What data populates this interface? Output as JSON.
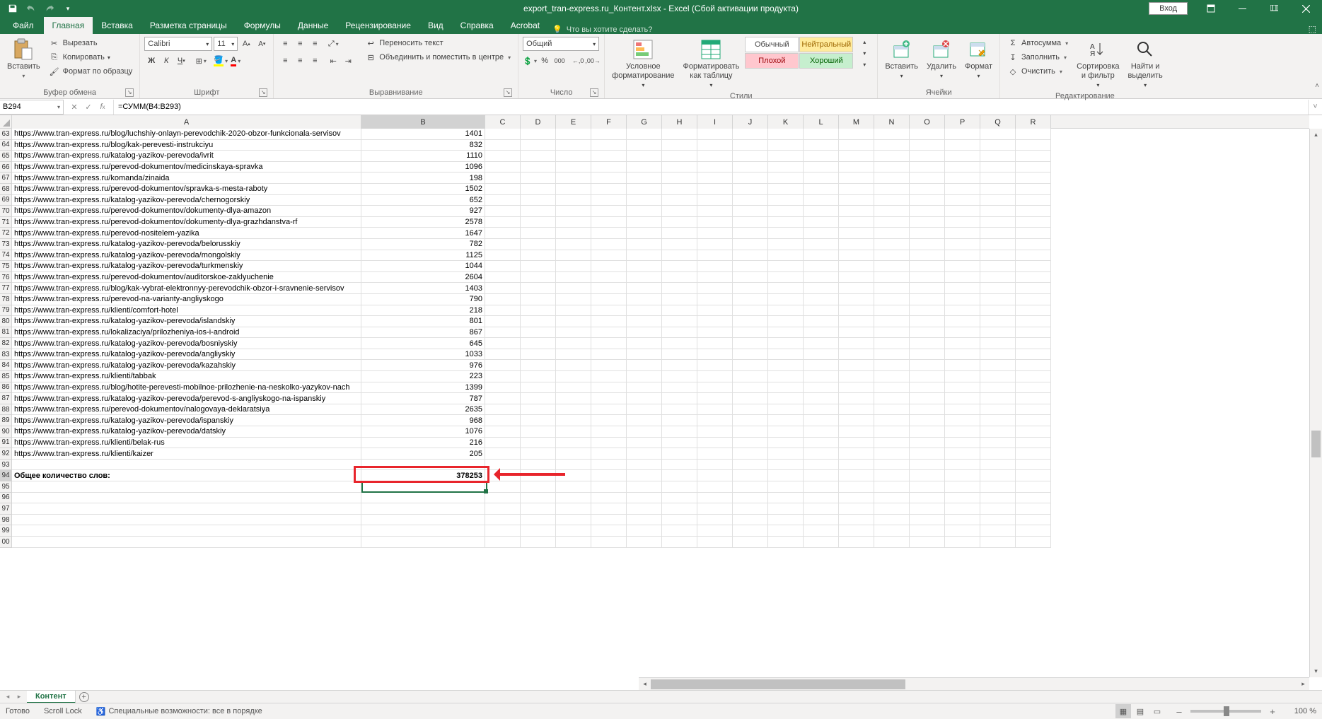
{
  "titlebar": {
    "filename": "export_tran-express.ru_Контент.xlsx - Excel (Сбой активации продукта)",
    "login": "Вход"
  },
  "tabs": {
    "file": "Файл",
    "home": "Главная",
    "insert": "Вставка",
    "layout": "Разметка страницы",
    "formulas": "Формулы",
    "data": "Данные",
    "review": "Рецензирование",
    "view": "Вид",
    "help": "Справка",
    "acrobat": "Acrobat",
    "tellme": "Что вы хотите сделать?"
  },
  "ribbon": {
    "clipboard": {
      "label": "Буфер обмена",
      "paste": "Вставить",
      "cut": "Вырезать",
      "copy": "Копировать",
      "format_painter": "Формат по образцу"
    },
    "font": {
      "label": "Шрифт",
      "family": "Calibri",
      "size": "11"
    },
    "align": {
      "label": "Выравнивание",
      "wrap": "Переносить текст",
      "merge": "Объединить и поместить в центре"
    },
    "number": {
      "label": "Число",
      "format": "Общий"
    },
    "styles": {
      "label": "Стили",
      "conditional": "Условное\nформатирование",
      "as_table": "Форматировать\nкак таблицу",
      "normal": "Обычный",
      "neutral": "Нейтральный",
      "bad": "Плохой",
      "good": "Хороший"
    },
    "cells": {
      "label": "Ячейки",
      "insert": "Вставить",
      "delete": "Удалить",
      "format": "Формат"
    },
    "editing": {
      "label": "Редактирование",
      "autosum": "Автосумма",
      "fill": "Заполнить",
      "clear": "Очистить",
      "sort": "Сортировка\nи фильтр",
      "find": "Найти и\nвыделить"
    }
  },
  "namebox": "B294",
  "formula": "=СУММ(B4:B293)",
  "columns": [
    "A",
    "B",
    "C",
    "D",
    "E",
    "F",
    "G",
    "H",
    "I",
    "J",
    "K",
    "L",
    "M",
    "N",
    "O",
    "P",
    "Q",
    "R"
  ],
  "col_widths": {
    "A": 494,
    "B": 175,
    "rest": 50
  },
  "rows": [
    {
      "n": 63,
      "a": "https://www.tran-express.ru/blog/luchshiy-onlayn-perevodchik-2020-obzor-funkcionala-servisov",
      "b": "1401"
    },
    {
      "n": 64,
      "a": "https://www.tran-express.ru/blog/kak-perevesti-instrukciyu",
      "b": "832"
    },
    {
      "n": 65,
      "a": "https://www.tran-express.ru/katalog-yazikov-perevoda/ivrit",
      "b": "1110"
    },
    {
      "n": 66,
      "a": "https://www.tran-express.ru/perevod-dokumentov/medicinskaya-spravka",
      "b": "1096"
    },
    {
      "n": 67,
      "a": "https://www.tran-express.ru/komanda/zinaida",
      "b": "198"
    },
    {
      "n": 68,
      "a": "https://www.tran-express.ru/perevod-dokumentov/spravka-s-mesta-raboty",
      "b": "1502"
    },
    {
      "n": 69,
      "a": "https://www.tran-express.ru/katalog-yazikov-perevoda/chernogorskiy",
      "b": "652"
    },
    {
      "n": 70,
      "a": "https://www.tran-express.ru/perevod-dokumentov/dokumenty-dlya-amazon",
      "b": "927"
    },
    {
      "n": 71,
      "a": "https://www.tran-express.ru/perevod-dokumentov/dokumenty-dlya-grazhdanstva-rf",
      "b": "2578"
    },
    {
      "n": 72,
      "a": "https://www.tran-express.ru/perevod-nositelem-yazika",
      "b": "1647"
    },
    {
      "n": 73,
      "a": "https://www.tran-express.ru/katalog-yazikov-perevoda/belorusskiy",
      "b": "782"
    },
    {
      "n": 74,
      "a": "https://www.tran-express.ru/katalog-yazikov-perevoda/mongolskiy",
      "b": "1125"
    },
    {
      "n": 75,
      "a": "https://www.tran-express.ru/katalog-yazikov-perevoda/turkmenskiy",
      "b": "1044"
    },
    {
      "n": 76,
      "a": "https://www.tran-express.ru/perevod-dokumentov/auditorskoe-zaklyuchenie",
      "b": "2604"
    },
    {
      "n": 77,
      "a": "https://www.tran-express.ru/blog/kak-vybrat-elektronnyy-perevodchik-obzor-i-sravnenie-servisov",
      "b": "1403"
    },
    {
      "n": 78,
      "a": "https://www.tran-express.ru/perevod-na-varianty-angliyskogo",
      "b": "790"
    },
    {
      "n": 79,
      "a": "https://www.tran-express.ru/klienti/comfort-hotel",
      "b": "218"
    },
    {
      "n": 80,
      "a": "https://www.tran-express.ru/katalog-yazikov-perevoda/islandskiy",
      "b": "801"
    },
    {
      "n": 81,
      "a": "https://www.tran-express.ru/lokalizaciya/prilozheniya-ios-i-android",
      "b": "867"
    },
    {
      "n": 82,
      "a": "https://www.tran-express.ru/katalog-yazikov-perevoda/bosniyskiy",
      "b": "645"
    },
    {
      "n": 83,
      "a": "https://www.tran-express.ru/katalog-yazikov-perevoda/angliyskiy",
      "b": "1033"
    },
    {
      "n": 84,
      "a": "https://www.tran-express.ru/katalog-yazikov-perevoda/kazahskiy",
      "b": "976"
    },
    {
      "n": 85,
      "a": "https://www.tran-express.ru/klienti/tabbak",
      "b": "223"
    },
    {
      "n": 86,
      "a": "https://www.tran-express.ru/blog/hotite-perevesti-mobilnoe-prilozhenie-na-neskolko-yazykov-nach",
      "b": "1399"
    },
    {
      "n": 87,
      "a": "https://www.tran-express.ru/katalog-yazikov-perevoda/perevod-s-angliyskogo-na-ispanskiy",
      "b": "787"
    },
    {
      "n": 88,
      "a": "https://www.tran-express.ru/perevod-dokumentov/nalogovaya-deklaratsiya",
      "b": "2635"
    },
    {
      "n": 89,
      "a": "https://www.tran-express.ru/katalog-yazikov-perevoda/ispanskiy",
      "b": "968"
    },
    {
      "n": 90,
      "a": "https://www.tran-express.ru/katalog-yazikov-perevoda/datskiy",
      "b": "1076"
    },
    {
      "n": 91,
      "a": "https://www.tran-express.ru/klienti/belak-rus",
      "b": "216"
    },
    {
      "n": 92,
      "a": "https://www.tran-express.ru/klienti/kaizer",
      "b": "205"
    },
    {
      "n": 93,
      "a": "",
      "b": ""
    },
    {
      "n": 94,
      "a": "Общее количество слов:",
      "b": "378253",
      "bold": true
    },
    {
      "n": 95,
      "a": "",
      "b": ""
    },
    {
      "n": 96,
      "a": "",
      "b": ""
    },
    {
      "n": 97,
      "a": "",
      "b": ""
    },
    {
      "n": 98,
      "a": "",
      "b": ""
    },
    {
      "n": 99,
      "a": "",
      "b": ""
    },
    {
      "n": "00",
      "a": "",
      "b": ""
    }
  ],
  "sheet": {
    "name": "Контент"
  },
  "status": {
    "ready": "Готово",
    "scroll": "Scroll Lock",
    "access": "Специальные возможности: все в порядке",
    "zoom": "100 %"
  }
}
